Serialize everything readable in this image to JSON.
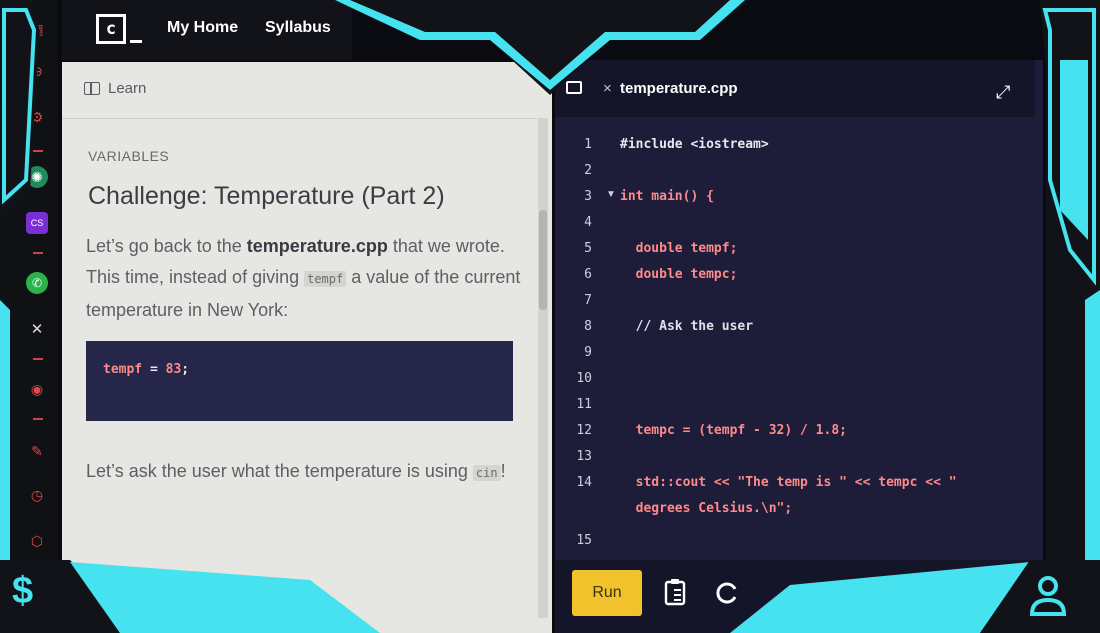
{
  "nav": {
    "logo": "c",
    "my_home": "My Home",
    "syllabus": "Syllabus"
  },
  "lesson": {
    "learn_label": "Learn",
    "section": "VARIABLES",
    "title": "Challenge: Temperature (Part 2)",
    "para1_a": "Let’s go back to the ",
    "para1_file": "temperature.cpp",
    "para1_b": " that we wrote. This time, instead of giving ",
    "para1_var": "tempf",
    "para1_c": " a value of the current temperature in New York:",
    "snippet_var": "tempf",
    "snippet_eq": " = ",
    "snippet_val": "83",
    "snippet_end": ";",
    "para2_a": "Let’s ask the user what the temperature is using ",
    "para2_cin": "cin",
    "para2_b": "!"
  },
  "editor": {
    "tab_close": "×",
    "filename": "temperature.cpp",
    "run_label": "Run",
    "lines": [
      {
        "n": "1",
        "text": "#include <iostream>",
        "color": "#e8e8f0"
      },
      {
        "n": "2",
        "text": "",
        "color": "#e8e8f0"
      },
      {
        "n": "3",
        "text": "int main() {",
        "color": "#ff8a8a"
      },
      {
        "n": "4",
        "text": "",
        "color": "#e8e8f0"
      },
      {
        "n": "5",
        "text": "  double tempf;",
        "color": "#ff8a8a"
      },
      {
        "n": "6",
        "text": "  double tempc;",
        "color": "#ff8a8a"
      },
      {
        "n": "7",
        "text": "",
        "color": "#e8e8f0"
      },
      {
        "n": "8",
        "text": "  // Ask the user",
        "color": "#e0e0ea"
      },
      {
        "n": "9",
        "text": "",
        "color": "#e8e8f0"
      },
      {
        "n": "10",
        "text": "",
        "color": "#e8e8f0"
      },
      {
        "n": "11",
        "text": "",
        "color": "#e8e8f0"
      },
      {
        "n": "12",
        "text": "  tempc = (tempf - 32) / 1.8;",
        "color": "#ff8a8a"
      },
      {
        "n": "13",
        "text": "",
        "color": "#e8e8f0"
      },
      {
        "n": "14",
        "text": "  std::cout << \"The temp is \" << tempc << \"",
        "color": "#ff8a8a"
      },
      {
        "n": "",
        "text": "  degrees Celsius.\\n\";",
        "color": "#ff8a8a"
      },
      {
        "n": "15",
        "text": "",
        "color": "#e8e8f0"
      }
    ]
  },
  "overlay": {
    "dollar": "$"
  },
  "colors": {
    "accent_cyan": "#3fe0f0",
    "run_yellow": "#f2c22c",
    "editor_bg": "#1d1d3a",
    "code_red": "#ff8a8a"
  },
  "strip_icons": [
    "bag-icon",
    "lock-icon",
    "settings-icon",
    "chatgpt-icon",
    "cs-icon",
    "whatsapp-icon",
    "x-icon",
    "play-icon",
    "edit-icon",
    "clock-icon",
    "cube-icon"
  ]
}
